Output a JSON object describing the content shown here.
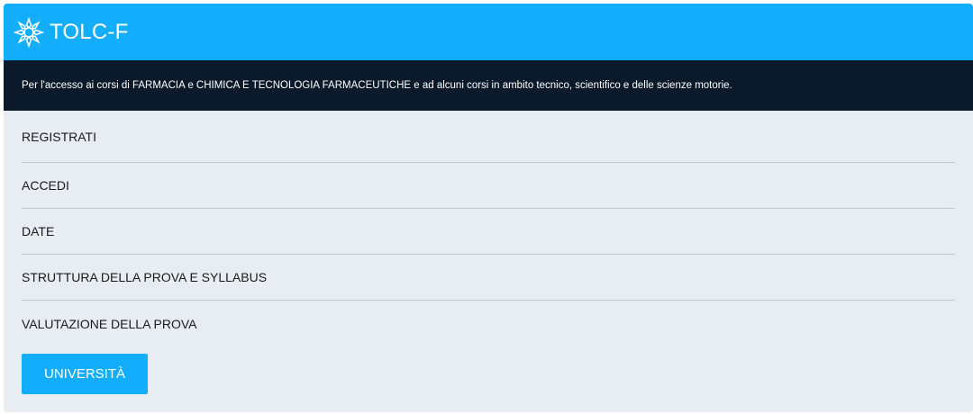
{
  "header": {
    "title": "TOLC-F",
    "logo_icon": "cisia-star-logo-icon",
    "background_color": "#13aefb"
  },
  "description": {
    "text": "Per l'accesso ai corsi di FARMACIA e CHIMICA E TECNOLOGIA FARMACEUTICHE e ad alcuni corsi in ambito tecnico, scientifico e delle scienze motorie.",
    "background_color": "#0b1a2b"
  },
  "menu": {
    "items": [
      {
        "label": "REGISTRATI"
      },
      {
        "label": "ACCEDI"
      },
      {
        "label": "DATE"
      },
      {
        "label": "STRUTTURA DELLA PROVA E SYLLABUS"
      },
      {
        "label": "VALUTAZIONE DELLA PROVA"
      }
    ]
  },
  "universities_button": {
    "label": "UNIVERSITÀ"
  }
}
